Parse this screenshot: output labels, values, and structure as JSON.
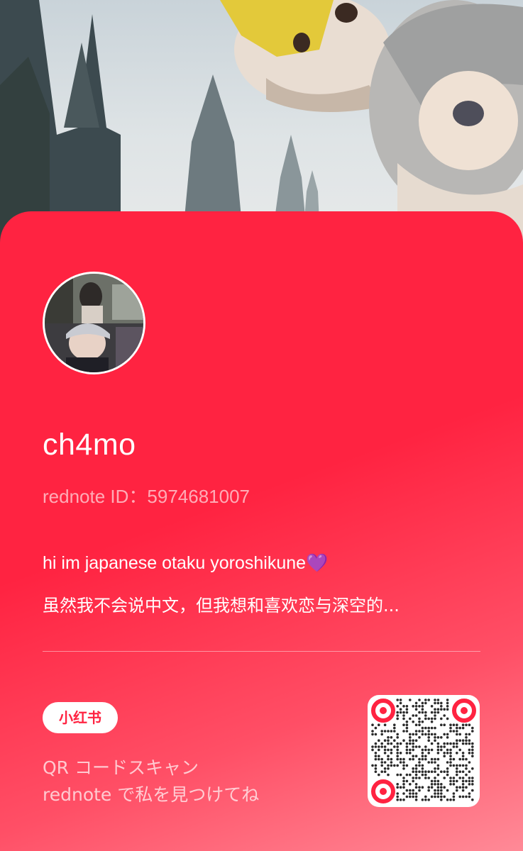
{
  "profile": {
    "username": "ch4mo",
    "rednote_id": "rednote ID：5974681007",
    "bio_line_1": "hi im japanese otaku yoroshikune",
    "bio_heart": "💜",
    "bio_line_2": "虽然我不会说中文，但我想和喜欢恋与深空的..."
  },
  "footer": {
    "logo_text": "小红书",
    "scan_line_1": "QR コードスキャン",
    "scan_line_2": "rednote で私を見つけてね"
  },
  "colors": {
    "card_red": "#ff2341",
    "accent_white": "#ffffff"
  },
  "icons": {
    "qr": "qr-code-icon",
    "avatar": "avatar"
  }
}
